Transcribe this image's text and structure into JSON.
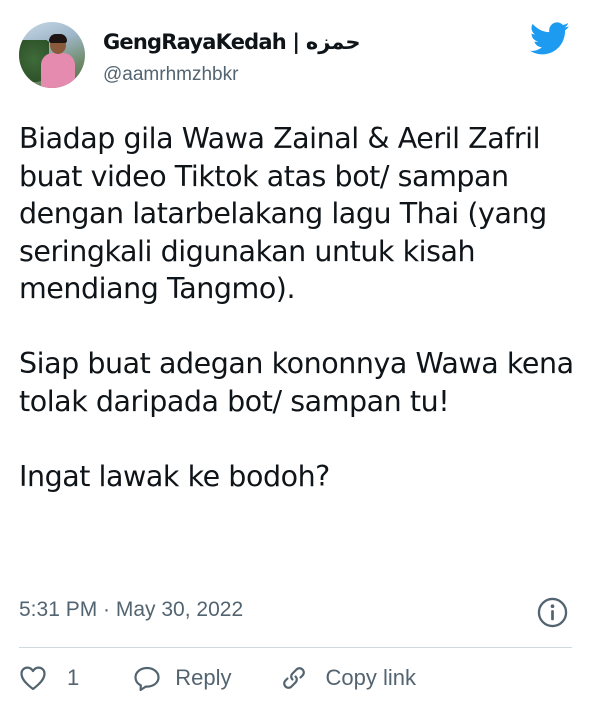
{
  "user": {
    "display_name": "GengRayaKedah | حمزه",
    "handle": "@aamrhmzhbkr"
  },
  "tweet": {
    "paragraphs": [
      "Biadap gila Wawa Zainal & Aeril Zafril buat video Tiktok atas bot/ sampan dengan latarbelakang lagu Thai (yang seringkali digunakan untuk kisah mendiang Tangmo).",
      "Siap buat adegan kononnya Wawa kena tolak daripada bot/ sampan tu!",
      "Ingat lawak ke bodoh?"
    ],
    "timestamp": "5:31 PM · May 30, 2022"
  },
  "actions": {
    "like_count": "1",
    "reply_label": "Reply",
    "copy_link_label": "Copy link"
  },
  "icons": {
    "brand": "twitter-bird-icon",
    "info": "info-icon",
    "like": "heart-icon",
    "reply": "speech-bubble-icon",
    "copy_link": "link-icon"
  },
  "colors": {
    "brand": "#1d9bf0",
    "text": "#0f1419",
    "secondary": "#536471",
    "divider": "#cfd9de"
  }
}
